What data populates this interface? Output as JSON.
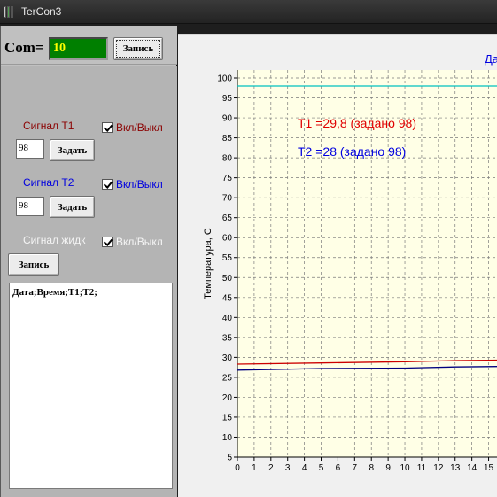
{
  "window": {
    "title": "TerCon3"
  },
  "com": {
    "label": "Com=",
    "value": "10",
    "record_button": "Запись"
  },
  "signal1": {
    "label": "Сигнал T1",
    "toggle_label": "Вкл/Выкл",
    "checked": true,
    "input_value": "98",
    "set_button": "Задать",
    "color": "#8b0000"
  },
  "signal2": {
    "label": "Сигнал T2",
    "toggle_label": "Вкл/Выкл",
    "checked": true,
    "input_value": "98",
    "set_button": "Задать",
    "color": "#0000e0"
  },
  "signal_liquid": {
    "label": "Сигнал жидк",
    "toggle_label": "Вкл/Выкл",
    "checked": true
  },
  "log": {
    "record_button": "Запись",
    "header": "Дата;Время;T1;T2;"
  },
  "chart": {
    "title_partial": "Да",
    "annotation_t1": "T1 =29,8 (задано 98)",
    "annotation_t2": "T2 =28 (задано 98)",
    "annotation_t1_color": "#e00000",
    "annotation_t2_color": "#0000e0"
  },
  "chart_data": {
    "type": "line",
    "ylabel": "Температура, С",
    "xlim": [
      0,
      15.5
    ],
    "ylim": [
      5,
      102
    ],
    "x_ticks": [
      "0",
      "1",
      "2",
      "3",
      "4",
      "5",
      "6",
      "7",
      "8",
      "9",
      "10",
      "11",
      "12",
      "13",
      "14",
      "15"
    ],
    "y_ticks": [
      "5",
      "10",
      "15",
      "20",
      "25",
      "30",
      "35",
      "40",
      "45",
      "50",
      "55",
      "60",
      "65",
      "70",
      "75",
      "80",
      "85",
      "90",
      "95",
      "100"
    ],
    "grid": true,
    "background": "#ffffe6",
    "series": [
      {
        "color": "#00c0c0",
        "x": [
          0,
          15.5
        ],
        "y": [
          98,
          98
        ]
      },
      {
        "color": "#cc0000",
        "x": [
          0,
          5,
          10,
          13,
          15.5
        ],
        "y": [
          28.3,
          28.6,
          28.9,
          29.2,
          29.3
        ]
      },
      {
        "color": "#000080",
        "x": [
          0,
          5,
          10,
          13,
          15.5
        ],
        "y": [
          26.8,
          27.2,
          27.3,
          27.6,
          27.7
        ]
      }
    ]
  }
}
